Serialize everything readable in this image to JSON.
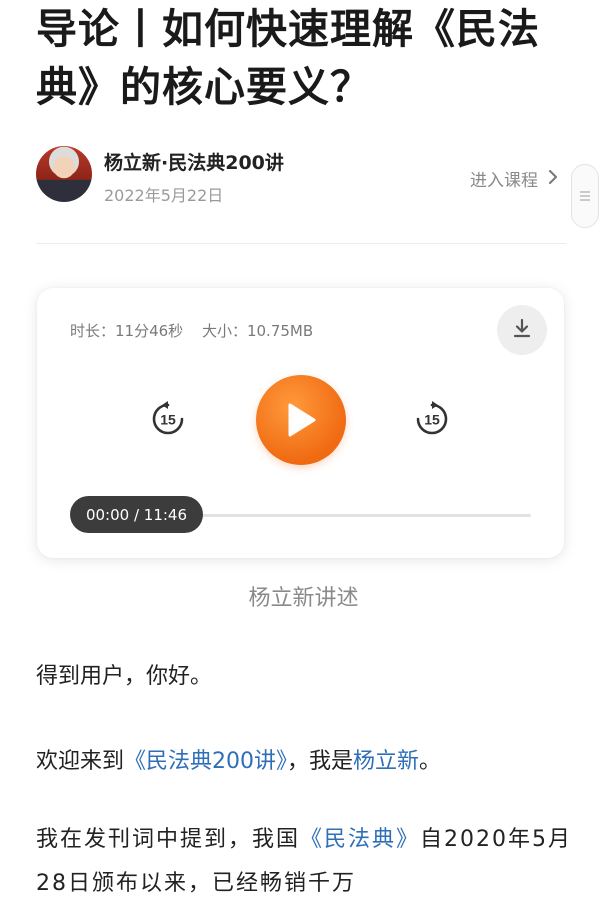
{
  "article": {
    "title": "导论丨如何快速理解《民法典》的核心要义？"
  },
  "author": {
    "name": "杨立新·民法典200讲",
    "date": "2022年5月22日",
    "enter_course": "进入课程",
    "enter_icon": "chevron-right-icon",
    "menu_icon": "list-icon"
  },
  "player": {
    "duration_text": "时长：11分46秒",
    "size_text": "大小：10.75MB",
    "skip_back_seconds": "15",
    "skip_forward_seconds": "15",
    "time_display": "00:00 / 11:46",
    "progress": 0.0,
    "play_color": "#f57c1f",
    "icons": [
      "download-icon",
      "rewind-15-icon",
      "play-icon",
      "forward-15-icon"
    ]
  },
  "narrator": "杨立新讲述",
  "body": {
    "p1": "得到用户，你好。",
    "p2_prefix": "欢迎来到",
    "p2_link1": "《民法典200讲》",
    "p2_mid": "，我是",
    "p2_link2": "杨立新",
    "p2_suffix": "。",
    "p3_prefix": "我在发刊词中提到，我国",
    "p3_link": "《民法典》",
    "p3_suffix": "自2020年5月28日颁布以来，已经畅销千万"
  }
}
